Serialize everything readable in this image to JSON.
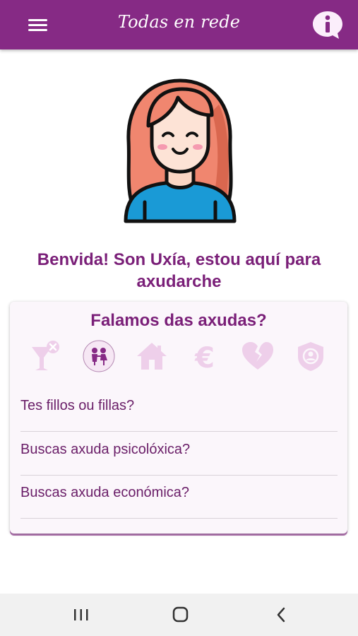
{
  "appbar": {
    "title": "Todas en rede",
    "background": "#862a85",
    "menu_icon": "hamburger-menu-icon",
    "info_icon": "info-chat-icon"
  },
  "welcome": {
    "text": "Benvida! Son Uxía, estou aquí para axudarche",
    "color": "#7a1f78"
  },
  "card": {
    "title": "Falamos das axudas?",
    "categories": [
      {
        "icon": "cancel-drink-icon",
        "selected": false
      },
      {
        "icon": "children-icon",
        "selected": true
      },
      {
        "icon": "house-icon",
        "selected": false
      },
      {
        "icon": "euro-icon",
        "selected": false
      },
      {
        "icon": "broken-heart-icon",
        "selected": false
      },
      {
        "icon": "shield-person-icon",
        "selected": false
      }
    ],
    "questions": [
      "Tes fillos ou fillas?",
      "Buscas axuda psicolóxica?",
      "Buscas axuda económica?"
    ]
  },
  "system_nav": {
    "buttons": [
      "recents-icon",
      "home-icon",
      "back-icon"
    ]
  }
}
